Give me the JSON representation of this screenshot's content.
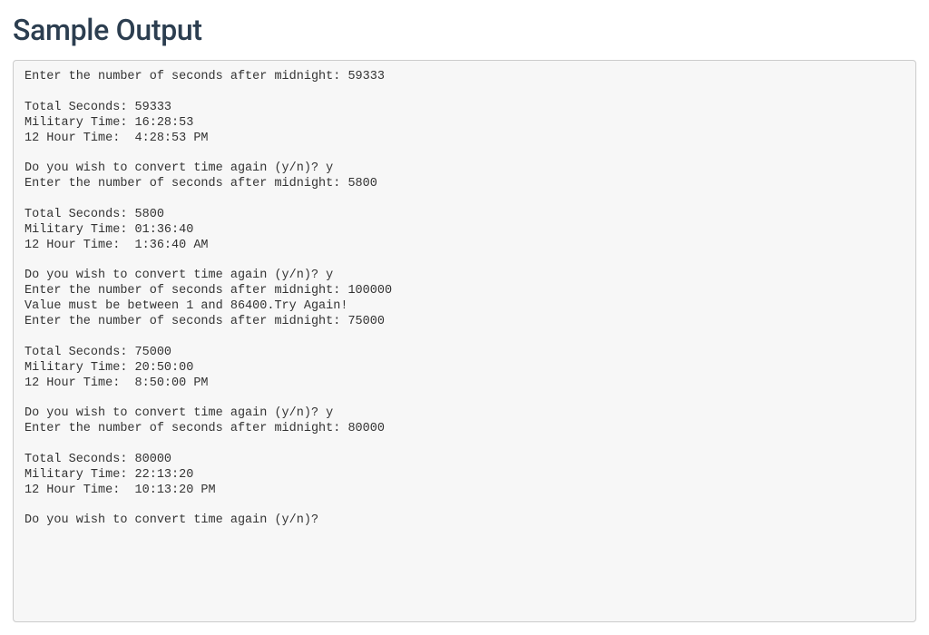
{
  "heading": "Sample Output",
  "console_output": "Enter the number of seconds after midnight: 59333\n\nTotal Seconds: 59333\nMilitary Time: 16:28:53\n12 Hour Time:  4:28:53 PM\n\nDo you wish to convert time again (y/n)? y\nEnter the number of seconds after midnight: 5800\n\nTotal Seconds: 5800\nMilitary Time: 01:36:40\n12 Hour Time:  1:36:40 AM\n\nDo you wish to convert time again (y/n)? y\nEnter the number of seconds after midnight: 100000\nValue must be between 1 and 86400.Try Again!\nEnter the number of seconds after midnight: 75000\n\nTotal Seconds: 75000\nMilitary Time: 20:50:00\n12 Hour Time:  8:50:00 PM\n\nDo you wish to convert time again (y/n)? y\nEnter the number of seconds after midnight: 80000\n\nTotal Seconds: 80000\nMilitary Time: 22:13:20\n12 Hour Time:  10:13:20 PM\n\nDo you wish to convert time again (y/n)?"
}
